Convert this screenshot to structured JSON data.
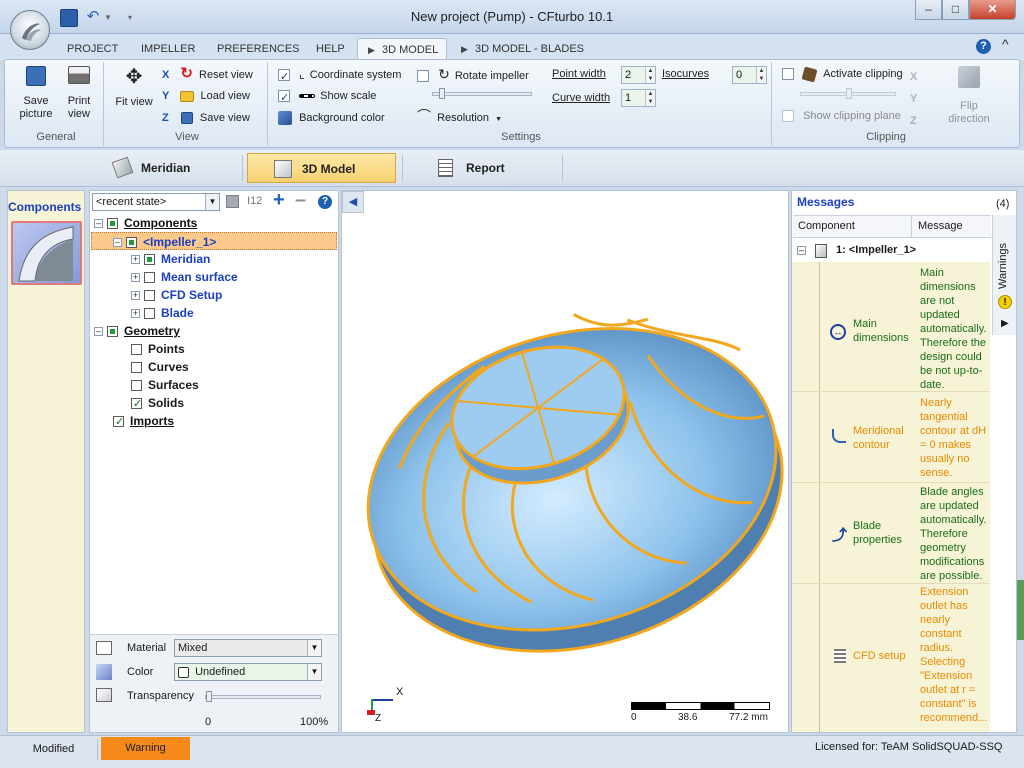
{
  "window": {
    "title": "New project (Pump) - CFturbo 10.1",
    "minimize": "–",
    "maximize": "□",
    "close": "✕"
  },
  "ribbon_tabs": [
    {
      "label": "PROJECT"
    },
    {
      "label": "IMPELLER"
    },
    {
      "label": "PREFERENCES"
    },
    {
      "label": "HELP"
    },
    {
      "label": "3D MODEL"
    },
    {
      "label": "3D MODEL - BLADES"
    }
  ],
  "help_symbol": "?",
  "ribbon": {
    "general": {
      "label": "General",
      "save_picture": "Save picture",
      "print_view": "Print view"
    },
    "view": {
      "label": "View",
      "fit_view": "Fit view",
      "reset_view": "Reset view",
      "load_view": "Load view",
      "save_view": "Save view"
    },
    "settings": {
      "label": "Settings",
      "coordinate_system": "Coordinate system",
      "show_scale": "Show scale",
      "background_color": "Background color",
      "rotate_impeller": "Rotate impeller",
      "resolution": "Resolution",
      "point_width_label": "Point width",
      "point_width_value": "2",
      "curve_width_label": "Curve width",
      "curve_width_value": "1",
      "isocurves_label": "Isocurves",
      "isocurves_value": "0"
    },
    "clipping": {
      "label": "Clipping",
      "activate_clipping": "Activate clipping",
      "show_clipping_plane": "Show clipping plane",
      "flip_direction": "Flip direction"
    }
  },
  "view_tabs": {
    "meridian": "Meridian",
    "model_3d": "3D Model",
    "report": "Report"
  },
  "components_panel": {
    "title": "Components"
  },
  "tree": {
    "state_combo": "<recent state>",
    "counter": "12",
    "rows": [
      {
        "label": "Components"
      },
      {
        "label": "<Impeller_1>"
      },
      {
        "label": "Meridian"
      },
      {
        "label": "Mean surface"
      },
      {
        "label": "CFD Setup"
      },
      {
        "label": "Blade"
      },
      {
        "label": "Geometry"
      },
      {
        "label": "Points"
      },
      {
        "label": "Curves"
      },
      {
        "label": "Surfaces"
      },
      {
        "label": "Solids"
      },
      {
        "label": "Imports"
      }
    ]
  },
  "material": {
    "material_label": "Material",
    "material_value": "Mixed",
    "color_label": "Color",
    "color_value": "Undefined",
    "transparency_label": "Transparency",
    "transparency_min": "0",
    "transparency_max": "100%",
    "transparency_value": 0
  },
  "viewport": {
    "axis_x": "X",
    "axis_z": "Z",
    "scale_0": "0",
    "scale_1": "38.6",
    "scale_2": "77.2 mm",
    "model_fill": "#8ec3ec",
    "model_edge": "#f2a71c"
  },
  "messages": {
    "title": "Messages",
    "count": "(4)",
    "col_component": "Component",
    "col_message": "Message",
    "group": "1: <Impeller_1>",
    "warnings_tab": "Warnings",
    "items": [
      {
        "component": "Main dimensions",
        "text": "Main dimensions are not updated automatically. Therefore the design could be not up-to-date.",
        "level": "info"
      },
      {
        "component": "Meridional contour",
        "text": "Nearly tangential contour at dH = 0 makes usually no sense.",
        "level": "warning"
      },
      {
        "component": "Blade properties",
        "text": "Blade angles are updated automatically. Therefore geometry modifications are possible.",
        "level": "info"
      },
      {
        "component": "CFD setup",
        "text": "Extension outlet has nearly constant radius. Selecting \"Extension outlet at r = constant\" is recommend...",
        "level": "warning"
      }
    ]
  },
  "status": {
    "modified": "Modified",
    "warning": "Warning",
    "license": "Licensed for: TeAM SolidSQUAD-SSQ"
  }
}
